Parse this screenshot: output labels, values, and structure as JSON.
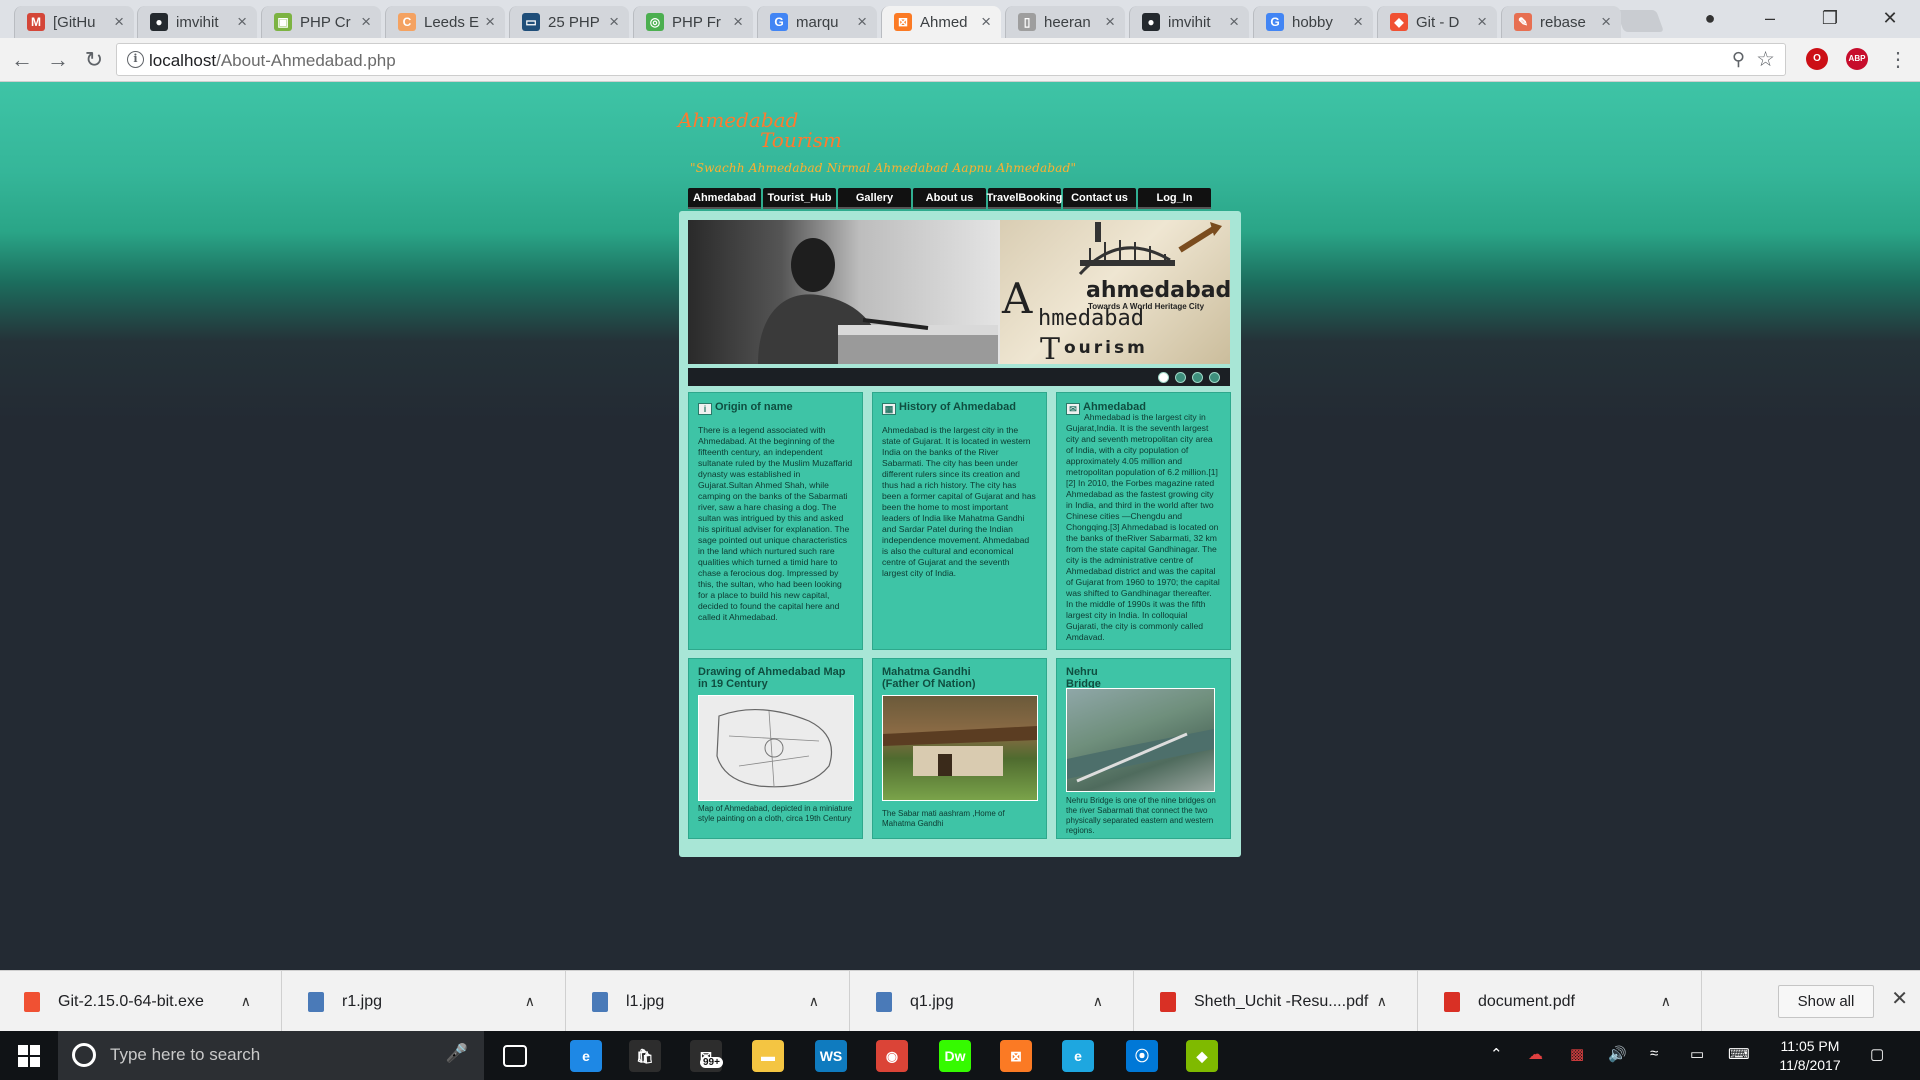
{
  "browser": {
    "tabs": [
      {
        "title": "[GitHu",
        "favicon": "gmail-icon",
        "color": "#d44638",
        "glyph": "M"
      },
      {
        "title": "imvihit",
        "favicon": "github-icon",
        "color": "#24292e",
        "glyph": "●"
      },
      {
        "title": "PHP Cr",
        "favicon": "php-icon",
        "color": "#7cb342",
        "glyph": "▣"
      },
      {
        "title": "Leeds E",
        "favicon": "leeds-icon",
        "color": "#f4a261",
        "glyph": "C"
      },
      {
        "title": "25 PHP",
        "favicon": "monitor-icon",
        "color": "#1f4e79",
        "glyph": "▭"
      },
      {
        "title": "PHP Fr",
        "favicon": "php-framework-icon",
        "color": "#4caf50",
        "glyph": "◎"
      },
      {
        "title": "marqu",
        "favicon": "google-icon",
        "color": "#4285f4",
        "glyph": "G"
      },
      {
        "title": "Ahmed",
        "favicon": "xampp-icon",
        "color": "#fb7a24",
        "glyph": "⊠",
        "active": true
      },
      {
        "title": "heeran",
        "favicon": "document-icon",
        "color": "#9e9e9e",
        "glyph": "▯"
      },
      {
        "title": "imvihit",
        "favicon": "github-icon",
        "color": "#24292e",
        "glyph": "●"
      },
      {
        "title": "hobby",
        "favicon": "google-icon",
        "color": "#4285f4",
        "glyph": "G"
      },
      {
        "title": "Git - D",
        "favicon": "git-icon",
        "color": "#f05133",
        "glyph": "◆"
      },
      {
        "title": "rebase",
        "favicon": "rebase-icon",
        "color": "#e76f51",
        "glyph": "✎"
      }
    ],
    "url_host": "localhost",
    "url_path": "/About-Ahmedabad.php",
    "ext_opera_label": "O",
    "ext_abp_label": "ABP"
  },
  "site": {
    "logo_line1": "Ahmedabad",
    "logo_line2": "Tourism",
    "tagline": "\"Swachh Ahmedabad Nirmal Ahmedabad Aapnu Ahmedabad\"",
    "menu": [
      "Ahmedabad",
      "Tourist_Hub",
      "Gallery",
      "About us",
      "TravelBooking",
      "Contact us",
      "Log_In"
    ],
    "slide_logo": {
      "big_a": "A",
      "word_ahmedabad": "ahmedabad",
      "sub": "Towards A World Heritage City",
      "word_hmedabad": "hmedabad",
      "big_t": "T",
      "word_ourism": "ourism"
    },
    "cards": [
      {
        "title": "Origin of name",
        "text": "There is a legend associated with Ahmedabad. At the beginning of the fifteenth century, an independent sultanate ruled by the Muslim Muzaffarid dynasty was established in Gujarat.Sultan Ahmed Shah, while camping on the banks of the Sabarmati river, saw a hare chasing a dog. The sultan was intrigued by this and asked his spiritual adviser for explanation. The sage pointed out unique characteristics in the land which nurtured such rare qualities which turned a timid hare to chase a ferocious dog. Impressed by this, the sultan, who had been looking for a place to build his new capital, decided to found the capital here and called it Ahmedabad."
      },
      {
        "title": "History of Ahmedabad",
        "text": "Ahmedabad is the largest city in the state of Gujarat. It is located in western India on the banks of the River Sabarmati. The city has been under different rulers since its creation and thus had a rich history. The city has been a former capital of Gujarat and has been the home to most important leaders of India like Mahatma Gandhi and Sardar Patel during the Indian independence movement. Ahmedabad is also the cultural and economical centre of Gujarat and the seventh largest city of India."
      },
      {
        "title": "Ahmedabad",
        "text": "Ahmedabad is the largest city in Gujarat,India. It is the seventh largest city and seventh metropolitan city area of India, with a city population of approximately 4.05 million and metropolitan population of 6.2 million.[1][2] In 2010, the Forbes magazine rated Ahmedabad as the fastest growing city in India, and third in the world after two Chinese cities —Chengdu and Chongqing.[3] Ahmedabad is located on the banks of theRiver Sabarmati, 32 km from the state capital Gandhinagar. The city is the administrative centre of Ahmedabad district and was the capital of Gujarat from 1960 to 1970; the capital was shifted to Gandhinagar thereafter. In the middle of 1990s it was the fifth largest city in India. In colloquial Gujarati, the city is commonly called Amdavad."
      }
    ],
    "photos": [
      {
        "title_l1": "Drawing of Ahmedabad Map",
        "title_l2": "in 19 Century",
        "caption": "Map of Ahmedabad, depicted in a miniature style painting on a cloth, circa 19th Century"
      },
      {
        "title_l1": "Mahatma Gandhi",
        "title_l2": "(Father Of Nation)",
        "caption": "The Sabar mati aashram ,Home of Mahatma Gandhi"
      },
      {
        "title_l1": "Nehru",
        "title_l2": "Bridge",
        "caption": "Nehru Bridge is one of the nine bridges on the river Sabarmati that connect the two physically separated eastern and western regions."
      }
    ]
  },
  "downloads": {
    "items": [
      {
        "name": "Git-2.15.0-64-bit.exe",
        "icon": "git-installer-icon",
        "color": "#f05133"
      },
      {
        "name": "r1.jpg",
        "icon": "image-file-icon",
        "color": "#4a7ab8"
      },
      {
        "name": "l1.jpg",
        "icon": "image-file-icon",
        "color": "#4a7ab8"
      },
      {
        "name": "q1.jpg",
        "icon": "image-file-icon",
        "color": "#4a7ab8"
      },
      {
        "name": "Sheth_Uchit -Resu....pdf",
        "icon": "pdf-file-icon",
        "color": "#d93025"
      },
      {
        "name": "document.pdf",
        "icon": "pdf-file-icon",
        "color": "#d93025"
      }
    ],
    "show_all": "Show all"
  },
  "taskbar": {
    "search_placeholder": "Type here to search",
    "mail_badge": "99+",
    "apps": [
      {
        "name": "edge-icon",
        "color": "#1e88e5",
        "glyph": "e"
      },
      {
        "name": "store-icon",
        "color": "#2d2d2d",
        "glyph": "🛍"
      },
      {
        "name": "mail-icon",
        "color": "#2d2d2d",
        "glyph": "✉"
      },
      {
        "name": "file-explorer-icon",
        "color": "#f4c542",
        "glyph": "▬"
      },
      {
        "name": "webstorm-icon",
        "color": "#0f7bbf",
        "glyph": "WS"
      },
      {
        "name": "chrome-icon",
        "color": "#db4437",
        "glyph": "◉"
      },
      {
        "name": "dreamweaver-icon",
        "color": "#35fa00",
        "glyph": "Dw"
      },
      {
        "name": "xampp-icon",
        "color": "#fb7a24",
        "glyph": "⊠"
      },
      {
        "name": "internet-explorer-icon",
        "color": "#1ea7e0",
        "glyph": "e"
      },
      {
        "name": "maps-icon",
        "color": "#0078d7",
        "glyph": "⦿"
      },
      {
        "name": "git-gui-icon",
        "color": "#7fba00",
        "glyph": "◆"
      }
    ],
    "time": "11:05 PM",
    "date": "11/8/2017"
  }
}
